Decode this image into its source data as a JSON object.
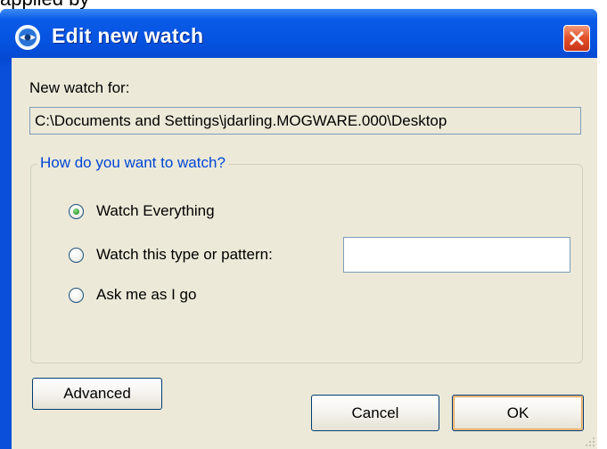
{
  "background_text": "applied by",
  "window": {
    "title": "Edit new watch",
    "app_icon": "app-logo-icon",
    "close_icon": "close-icon"
  },
  "dialog": {
    "new_watch_label": "New watch for:",
    "path_value": "C:\\Documents and Settings\\jdarling.MOGWARE.000\\Desktop",
    "group_title": "How do you want to watch?",
    "options": [
      {
        "label": "Watch Everything",
        "checked": true
      },
      {
        "label": "Watch this type or pattern:",
        "checked": false
      },
      {
        "label": "Ask me as I go",
        "checked": false
      }
    ],
    "pattern_value": "",
    "advanced_label": "Advanced",
    "cancel_label": "Cancel",
    "ok_label": "OK"
  },
  "colors": {
    "titlebar": "#0553e0",
    "client": "#ece9d8",
    "group_title": "#0046d5",
    "close_button": "#e2542c"
  }
}
